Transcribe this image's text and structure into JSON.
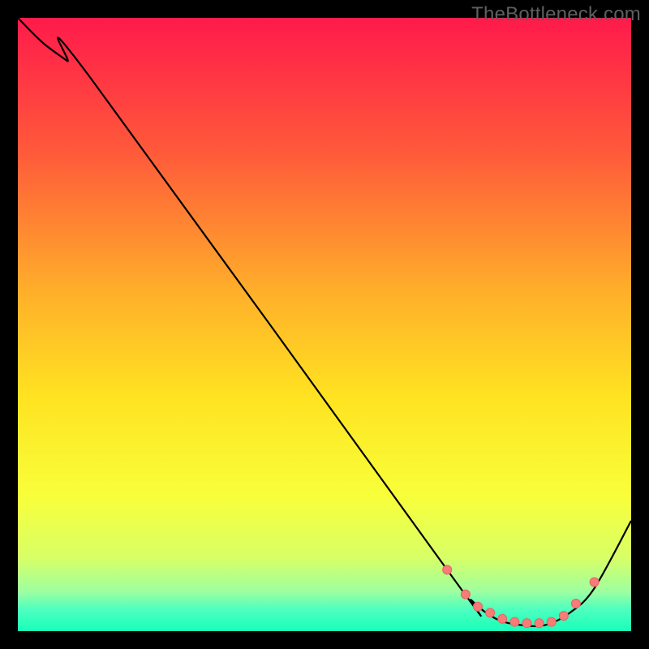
{
  "watermark": "TheBottleneck.com",
  "colors": {
    "bg": "#000000",
    "curve": "#000000",
    "marker_fill": "#f77b78",
    "marker_stroke": "#e86461"
  },
  "chart_data": {
    "type": "line",
    "title": "",
    "xlabel": "",
    "ylabel": "",
    "xlim": [
      0,
      100
    ],
    "ylim": [
      0,
      100
    ],
    "gradient_stops": [
      {
        "offset": 0,
        "color": "#ff1a4b"
      },
      {
        "offset": 22,
        "color": "#ff5a3a"
      },
      {
        "offset": 45,
        "color": "#ffb02a"
      },
      {
        "offset": 62,
        "color": "#ffe321"
      },
      {
        "offset": 78,
        "color": "#f8ff3a"
      },
      {
        "offset": 88,
        "color": "#d8ff66"
      },
      {
        "offset": 93.5,
        "color": "#9effa0"
      },
      {
        "offset": 96.5,
        "color": "#4dffc0"
      },
      {
        "offset": 100,
        "color": "#18ffb8"
      }
    ],
    "series": [
      {
        "name": "bottleneck-curve",
        "x": [
          0,
          4,
          8,
          12,
          70,
          74,
          78,
          82,
          86,
          90,
          94,
          100
        ],
        "y": [
          100,
          96,
          93,
          90,
          10,
          5,
          2,
          1,
          1,
          3,
          7,
          18
        ]
      }
    ],
    "markers": {
      "name": "optimum-range",
      "x": [
        70,
        73,
        75,
        77,
        79,
        81,
        83,
        85,
        87,
        89,
        91,
        94
      ],
      "y": [
        10,
        6,
        4,
        3,
        2,
        1.5,
        1.3,
        1.3,
        1.5,
        2.5,
        4.5,
        8
      ]
    }
  }
}
